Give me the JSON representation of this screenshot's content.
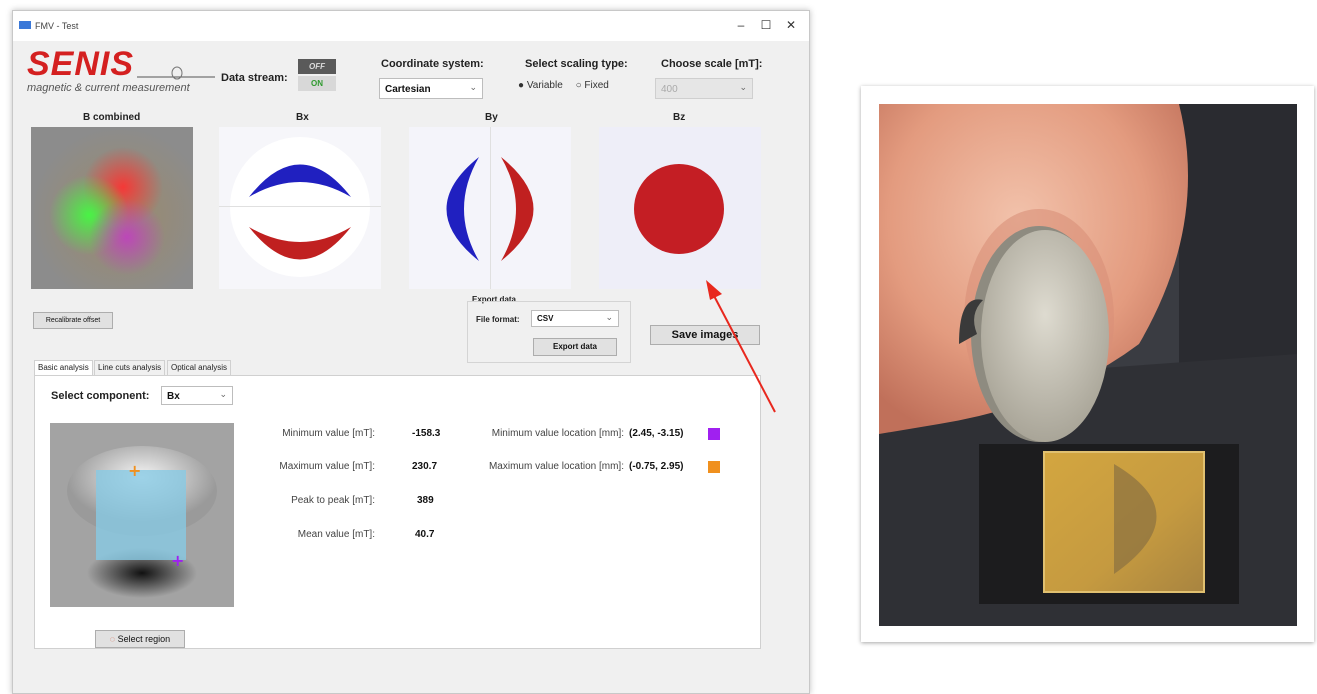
{
  "window": {
    "title": "FMV - Test"
  },
  "logo": {
    "brand": "SENIS",
    "tagline": "magnetic & current measurement"
  },
  "data_stream": {
    "label": "Data stream:",
    "off": "OFF",
    "on": "ON"
  },
  "coordinate": {
    "label": "Coordinate system:",
    "value": "Cartesian"
  },
  "scaling": {
    "label": "Select scaling type:",
    "options": [
      "Variable",
      "Fixed"
    ],
    "selected": "Variable"
  },
  "scale": {
    "label": "Choose scale [mT]:",
    "value": "400"
  },
  "maps": {
    "titles": [
      "B combined",
      "Bx",
      "By",
      "Bz"
    ]
  },
  "recalibrate": {
    "label": "Recalibrate offset"
  },
  "export": {
    "title": "Export data",
    "format_label": "File format:",
    "format_value": "CSV",
    "button": "Export data"
  },
  "save_images": {
    "label": "Save images"
  },
  "tabs": [
    "Basic analysis",
    "Line cuts analysis",
    "Optical analysis"
  ],
  "analysis": {
    "component_label": "Select component:",
    "component_value": "Bx",
    "select_region": "Select region",
    "min_label": "Minimum value [mT]:",
    "min_value": "-158.3",
    "max_label": "Maximum value [mT]:",
    "max_value": "230.7",
    "p2p_label": "Peak to peak [mT]:",
    "p2p_value": "389",
    "mean_label": "Mean value [mT]:",
    "mean_value": "40.7",
    "min_loc_label": "Minimum value location [mm]:",
    "min_loc_value": "(2.45, -3.15)",
    "max_loc_label": "Maximum value location [mm]:",
    "max_loc_value": "(-0.75, 2.95)",
    "min_color": "#a020f0",
    "max_color": "#f0901e"
  }
}
